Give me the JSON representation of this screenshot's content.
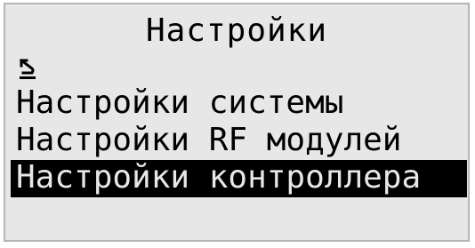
{
  "header": {
    "title": "Настройки"
  },
  "back": {
    "icon": "back-arrow-icon"
  },
  "menu": {
    "items": [
      {
        "label": "Настройки системы",
        "selected": false
      },
      {
        "label": "Настройки RF модулей",
        "selected": false
      },
      {
        "label": "Настройки контроллера",
        "selected": true
      }
    ]
  },
  "colors": {
    "background": "#e7e7e7",
    "text": "#000000",
    "selection": "#000000"
  }
}
